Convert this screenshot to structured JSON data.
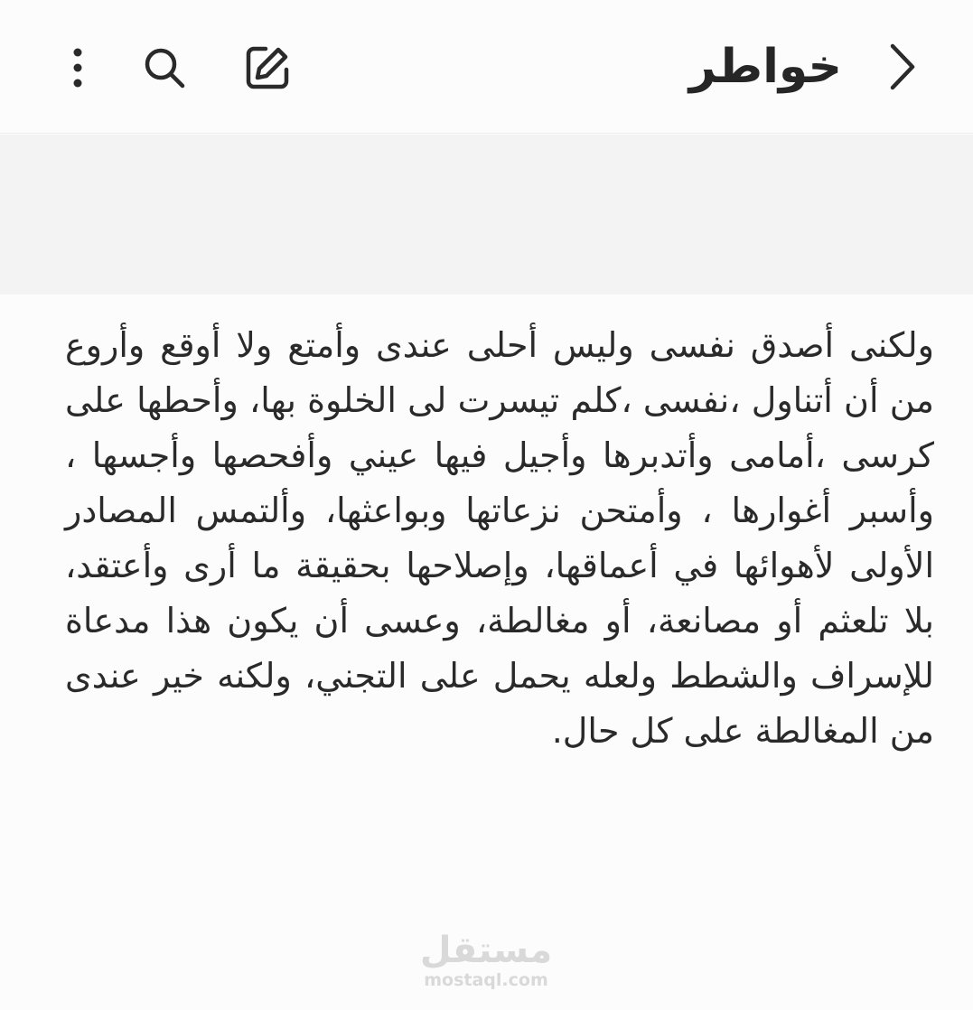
{
  "header": {
    "title": "خواطر",
    "icons": {
      "back": "chevron-right-icon",
      "edit": "edit-note-icon",
      "search": "search-icon",
      "more": "more-vertical-icon"
    }
  },
  "note": {
    "body": "ولكنى أصدق نفسى وليس أحلى عندى وأمتع ولا أوقع وأروع من أن أتناول ،نفسى ،كلم تيسرت لى الخلوة بها، وأحطها على كرسى ،أمامى وأتدبرها وأجيل فيها عيني وأفحصها وأجسها ، وأسبر أغوارها ، وأمتحن نزعاتها وبواعثها، وألتمس المصادر الأولى لأهوائها في أعماقها، وإصلاحها بحقيقة ما أرى وأعتقد، بلا تلعثم أو مصانعة، أو مغالطة، وعسى أن يكون هذا مدعاة للإسراف والشطط ولعله يحمل على التجني، ولكنه خير عندى من المغالطة على كل حال."
  },
  "watermark": {
    "arabic": "مستقل",
    "latin": "mostaql.com"
  },
  "colors": {
    "background": "#fcfcfc",
    "banner": "#f3f3f3",
    "text": "#2a2a2a",
    "watermark": "#d9d9d9"
  }
}
